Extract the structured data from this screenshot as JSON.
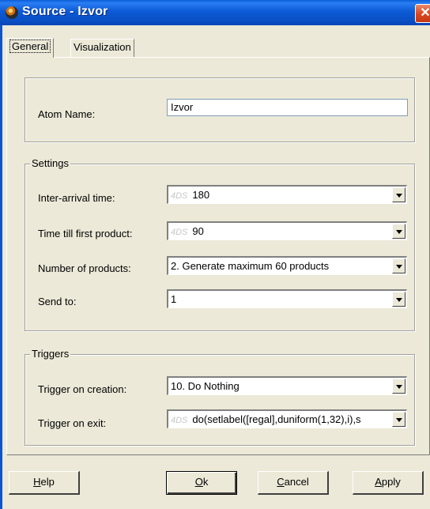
{
  "window": {
    "title": "Source - Izvor"
  },
  "tabs": [
    {
      "label": "General"
    },
    {
      "label": "Visualization"
    }
  ],
  "atom": {
    "label": "Atom Name:",
    "value": "Izvor"
  },
  "settings": {
    "legend": "Settings",
    "inter_arrival": {
      "label": "Inter-arrival time:",
      "tag": "4DS",
      "value": "180"
    },
    "first_product": {
      "label": "Time till first product:",
      "tag": "4DS",
      "value": "90"
    },
    "num_products": {
      "label": "Number of products:",
      "value": "2. Generate maximum 60 products"
    },
    "send_to": {
      "label": "Send to:",
      "value": "1"
    }
  },
  "triggers": {
    "legend": "Triggers",
    "on_creation": {
      "label": "Trigger on creation:",
      "value": "10. Do Nothing"
    },
    "on_exit": {
      "label": "Trigger on exit:",
      "tag": "4DS",
      "value": "do(setlabel([regal],duniform(1,32),i),s"
    }
  },
  "buttons": {
    "help": {
      "first": "H",
      "rest": "elp"
    },
    "ok": {
      "first": "O",
      "rest": "k"
    },
    "cancel": {
      "first": "C",
      "rest": "ancel"
    },
    "apply": {
      "first": "A",
      "rest": "pply"
    }
  },
  "icons": {
    "app": "source-app-icon",
    "close": "close-icon",
    "dropdown": "dropdown-arrow-icon"
  },
  "colors": {
    "titlebar": "#0a5fd8",
    "close": "#d9461e",
    "face": "#ece9d8"
  }
}
